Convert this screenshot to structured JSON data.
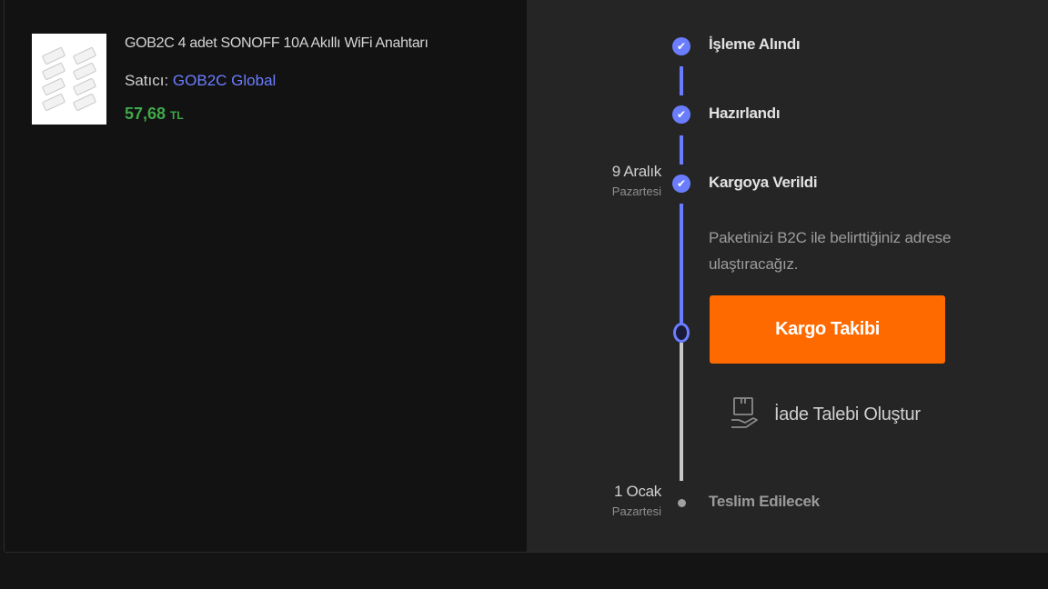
{
  "product": {
    "name": "GOB2C 4 adet SONOFF 10A Akıllı WiFi Anahtarı",
    "seller_label": "Satıcı: ",
    "seller_name": "GOB2C Global",
    "price": "57,68",
    "currency": "TL"
  },
  "timeline": {
    "steps": [
      {
        "title": "İşleme Alındı",
        "status": "done"
      },
      {
        "title": "Hazırlandı",
        "status": "done"
      },
      {
        "title": "Kargoya Verildi",
        "status": "done",
        "date_day": "9 Aralık",
        "date_weekday": "Pazartesi"
      },
      {
        "title": "Teslim Edilecek",
        "status": "pending",
        "date_day": "1 Ocak",
        "date_weekday": "Pazartesi"
      }
    ],
    "description_line1": "Paketinizi B2C ile belirttiğiniz adrese",
    "description_line2": "ulaştıracağız.",
    "track_button": "Kargo Takibi",
    "return_link": "İade Talebi Oluştur"
  },
  "colors": {
    "accent": "#6b7dff",
    "cta": "#ff6a00",
    "price": "#3fa84a"
  },
  "icons": {
    "step_done": "check-circle-icon",
    "return": "return-box-hand-icon"
  }
}
